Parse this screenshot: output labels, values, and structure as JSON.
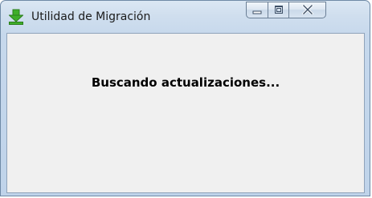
{
  "window": {
    "title": "Utilidad de Migración",
    "app_icon": "download-arrow-icon",
    "caption_buttons": [
      "minimize-icon",
      "maximize-icon",
      "close-icon"
    ]
  },
  "content": {
    "status_text": "Buscando actualizaciones..."
  },
  "colors": {
    "client_background": "#f0f0f0",
    "icon_green": "#3fae2a"
  }
}
